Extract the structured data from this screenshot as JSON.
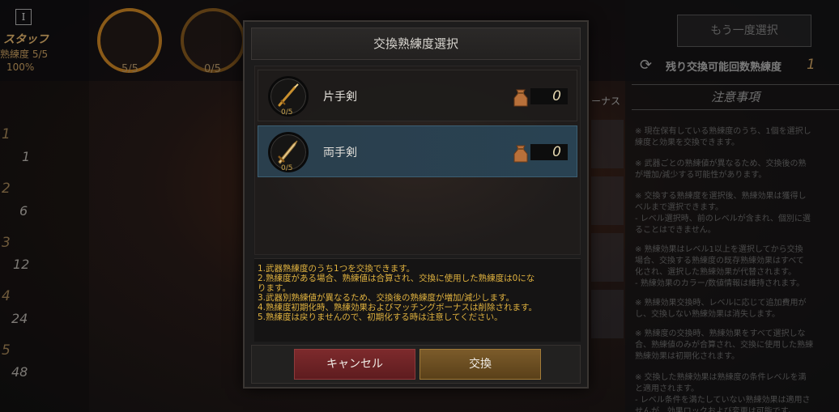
{
  "background": {
    "left_panel": {
      "icon_label": "I",
      "title": "スタッフ",
      "proficiency": "熟練度 5/5",
      "percent": "100%",
      "rings": [
        "5/5",
        "0/5"
      ],
      "levels": [
        {
          "level": "1",
          "value": "1"
        },
        {
          "level": "2",
          "value": "6"
        },
        {
          "level": "3",
          "value": "12"
        },
        {
          "level": "4",
          "value": "24"
        },
        {
          "level": "5",
          "value": "48"
        }
      ]
    },
    "bonus_label": "ーナス",
    "right_panel": {
      "again_button": "もう一度選択",
      "remaining_label": "残り交換可能回数熟練度",
      "remaining_value": "1",
      "notes_title": "注意事項",
      "notes": [
        "※ 現在保有している熟練度のうち、1個を選択し",
        "練度と効果を交換できます。",
        "※ 武器ごとの熟練値が異なるため、交換後の熟",
        "が増加/減少する可能性があります。",
        "※ 交換する熟練度を選択後、熟練効果は獲得し",
        "ベルまで選択できます。",
        "- レベル選択時、前のレベルが含まれ、個別に選",
        "ることはできません。",
        "※ 熟練効果はレベル1以上を選択してから交換",
        "場合、交換する熟練度の既存熟練効果はすべて",
        "化され、選択した熟練効果が代替されます。",
        "- 熟練効果のカラー/数値情報は維持されます。",
        "※ 熟練効果交換時、レベルに応じて追加費用が",
        "し、交換しない熟練効果は消失します。",
        "※ 熟練度の交換時、熟練効果をすべて選択しな",
        "合、熟練値のみが合算され、交換に使用した熟練",
        "熟練効果は初期化されます。",
        "※ 交換した熟練効果は熟練度の条件レベルを満",
        "と適用されます。",
        "- レベル条件を満たしていない熟練効果は適用さ",
        "せんが、効果ロックおよび変更は可能です。"
      ]
    }
  },
  "modal": {
    "title": "交換熟練度選択",
    "items": [
      {
        "name": "片手剣",
        "count": "0/5",
        "value": "0",
        "selected": false,
        "icon": "one-handed-sword-icon"
      },
      {
        "name": "両手剣",
        "count": "0/5",
        "value": "0",
        "selected": true,
        "icon": "two-handed-sword-icon"
      }
    ],
    "info": [
      "1.武器熟練度のうち1つを交換できます。",
      "2.熟練度がある場合、熟練値は合算され、交換に使用した熟練度は0にな",
      "ります。",
      "3.武器別熟練値が異なるため、交換後の熟練度が増加/減少します。",
      "4.熟練度初期化時、熟練効果およびマッチングボーナスは削除されます。",
      "5.熟練度は戻りませんので、初期化する時は注意してください。"
    ],
    "cancel_label": "キャンセル",
    "exchange_label": "交換"
  },
  "colors": {
    "accent_gold": "#e0b23f",
    "selected_row": "#294252",
    "cancel_button": "#7d2a2c",
    "exchange_button": "#7b5b2a"
  }
}
